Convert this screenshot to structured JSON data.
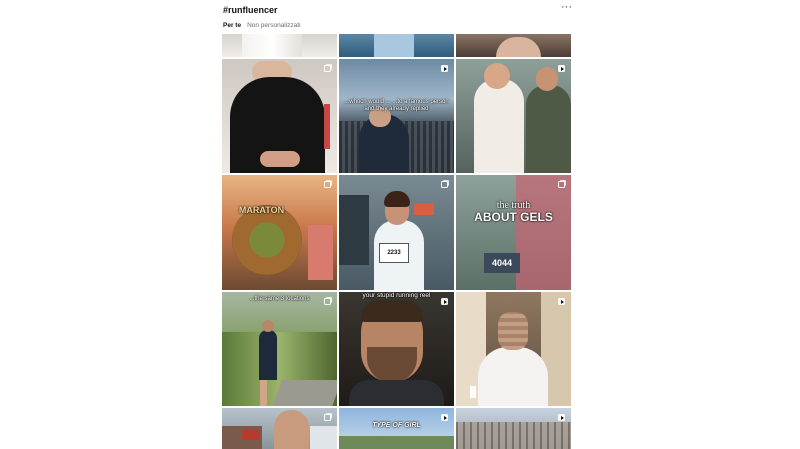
{
  "header": {
    "hashtag": "#runfluencer",
    "more_label": "···"
  },
  "tabs": {
    "active": "Per te",
    "other": "Non personalizzati"
  },
  "tiles": {
    "t1_3_caption": "",
    "t2_2_caption": "...whoch would ... ...to a famous person and they already replied",
    "t3_1_caption": "MARATON",
    "t3_3_caption_top": "the truth",
    "t3_3_caption_bottom": "ABOUT GELS",
    "t3_3_bib": "4044",
    "t3_2_bib": "2233",
    "t4_1_caption": "...the same 3 locations",
    "t4_2_caption": "your stupid running reel",
    "t5_2_caption": "TYPE OF GIRL"
  },
  "colors": {
    "badge": "#ffffff"
  }
}
